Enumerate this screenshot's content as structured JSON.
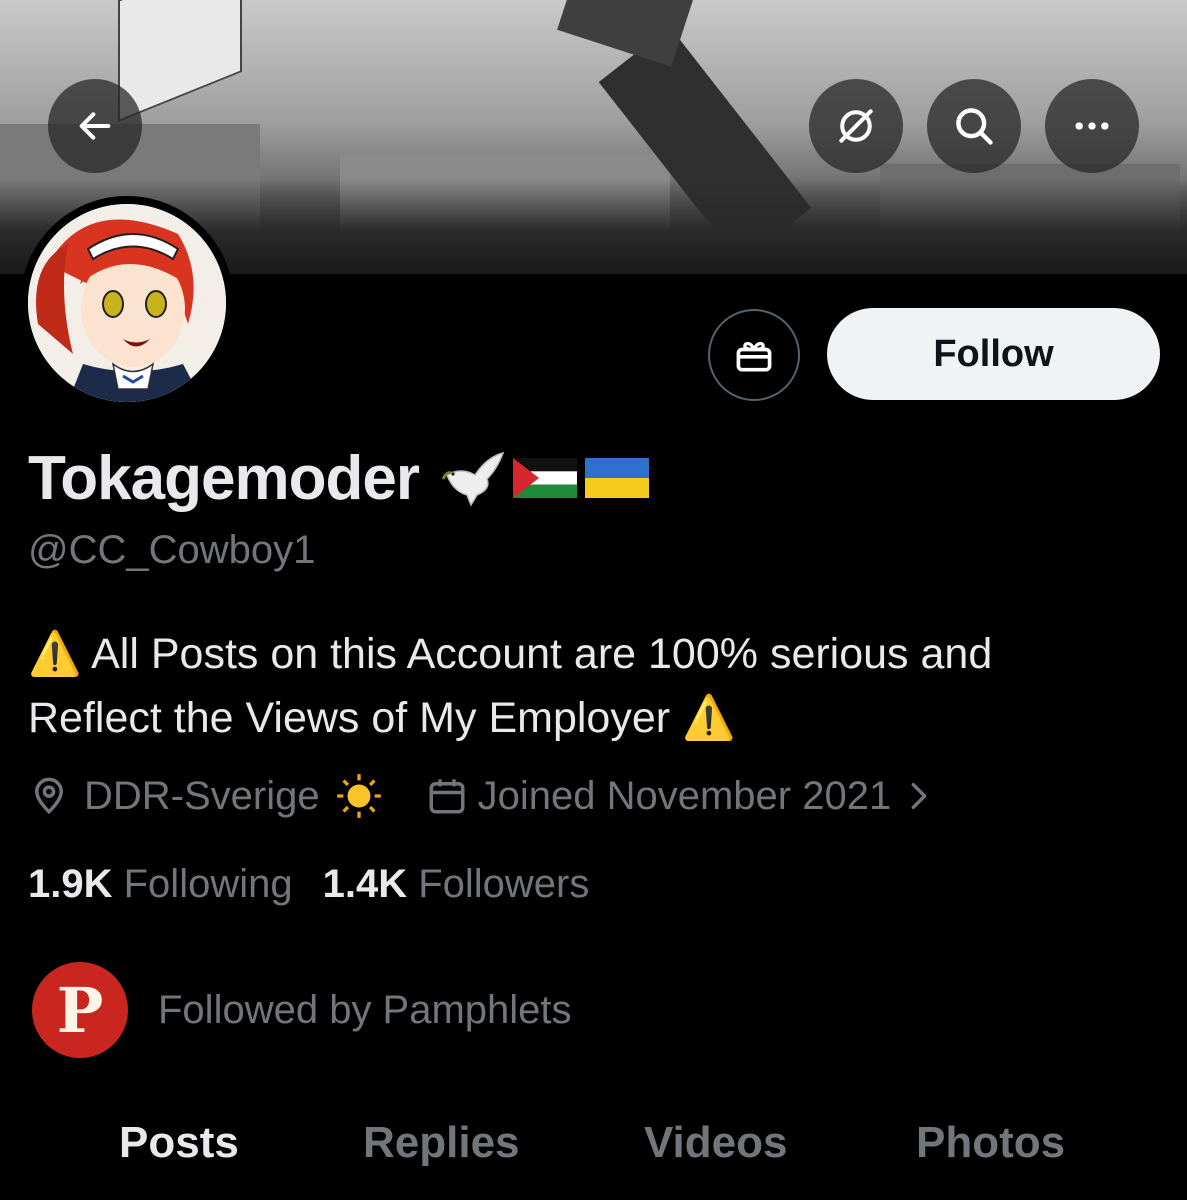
{
  "header": {
    "back_icon": "arrow-left-icon",
    "grok_icon": "grok-icon",
    "search_icon": "search-icon",
    "more_icon": "more-horizontal-icon"
  },
  "actions": {
    "gift_icon": "gift-icon",
    "follow_label": "Follow"
  },
  "profile": {
    "display_name": "Tokagemoder",
    "name_emojis": [
      "dove",
      "flag-palestine",
      "flag-ukraine"
    ],
    "handle": "@CC_Cowboy1",
    "bio_line1": "⚠️ All Posts on this Account are 100% serious and",
    "bio_line2": "Reflect the Views of My Employer ⚠️",
    "location": "DDR-Sverige",
    "location_emoji": "☀️",
    "joined": "Joined November 2021",
    "following_count": "1.9K",
    "following_label": "Following",
    "followers_count": "1.4K",
    "followers_label": "Followers"
  },
  "followed_by": {
    "logo_letter": "P",
    "text": "Followed by Pamphlets"
  },
  "tabs": [
    {
      "label": "Posts",
      "active": true
    },
    {
      "label": "Replies",
      "active": false
    },
    {
      "label": "Videos",
      "active": false
    },
    {
      "label": "Photos",
      "active": false
    }
  ],
  "colors": {
    "background": "#000000",
    "primary_text": "#e7e9ea",
    "secondary_text": "#71767b",
    "follow_button_bg": "#eff3f4",
    "pamphlets_red": "#c8261f"
  }
}
